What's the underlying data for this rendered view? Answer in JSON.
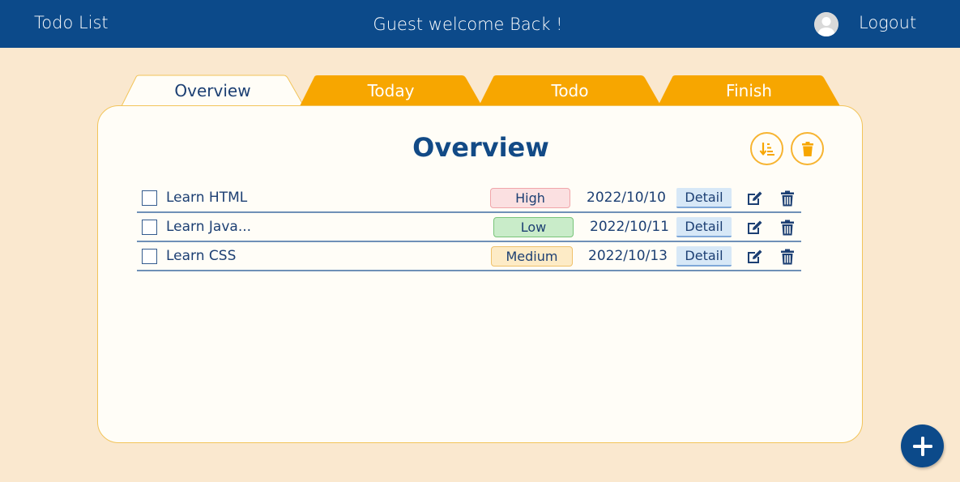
{
  "header": {
    "app_title": "Todo List",
    "welcome": "Guest welcome Back !",
    "logout_label": "Logout"
  },
  "tabs": [
    {
      "label": "Overview",
      "active": true
    },
    {
      "label": "Today",
      "active": false
    },
    {
      "label": "Todo",
      "active": false
    },
    {
      "label": "Finish",
      "active": false
    }
  ],
  "panel": {
    "title": "Overview"
  },
  "tasks": [
    {
      "name": "Learn HTML",
      "priority": "High",
      "date": "2022/10/10",
      "detail_label": "Detail"
    },
    {
      "name": "Learn Java...",
      "priority": "Low",
      "date": "2022/10/11",
      "detail_label": "Detail"
    },
    {
      "name": "Learn CSS",
      "priority": "Medium",
      "date": "2022/10/13",
      "detail_label": "Detail"
    }
  ],
  "icons": {
    "sort": "sort-icon",
    "trash": "trash-icon",
    "edit": "edit-icon",
    "delete": "delete-icon",
    "add": "plus-icon",
    "avatar": "user-avatar-icon"
  },
  "colors": {
    "header": "#0c4a8a",
    "tab_inactive": "#f7a600",
    "page_background": "#fae8cf",
    "accent": "#f7b431"
  }
}
